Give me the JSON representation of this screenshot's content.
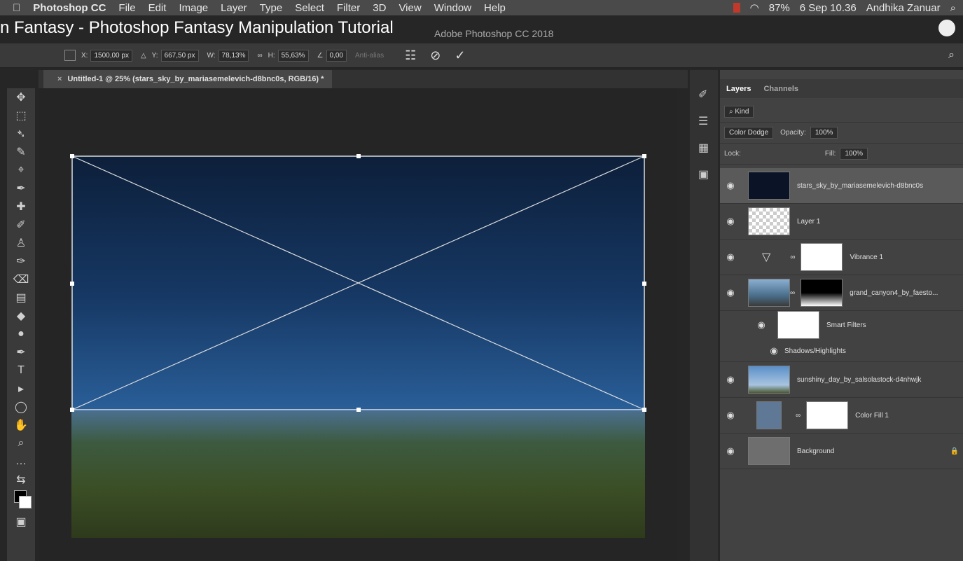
{
  "menubar": {
    "apple": "",
    "app": "Photoshop CC",
    "items": [
      "File",
      "Edit",
      "Image",
      "Layer",
      "Type",
      "Select",
      "Filter",
      "3D",
      "View",
      "Window",
      "Help"
    ],
    "battery": "87%",
    "clock": "6 Sep 10.36",
    "user": "Andhika Zanuar"
  },
  "overlay_title": "n Fantasy - Photoshop Fantasy Manipulation Tutorial",
  "window_title": "Adobe Photoshop CC 2018",
  "options": {
    "x_label": "X:",
    "x_value": "1500,00 px",
    "y_label": "Y:",
    "y_value": "667,50 px",
    "w_label": "W:",
    "w_value": "78,13%",
    "h_label": "H:",
    "h_value": "55,63%",
    "angle_value": "0,00",
    "antialias": "Anti-alias"
  },
  "document_tab": "Untitled-1 @ 25% (stars_sky_by_mariasemelevich-d8bnc0s, RGB/16) *",
  "layers_panel": {
    "tabs": [
      "Layers",
      "Channels"
    ],
    "kind_placeholder": "Kind",
    "blend_mode": "Color Dodge",
    "opacity_label": "Opacity:",
    "opacity_value": "100%",
    "lock_label": "Lock:",
    "fill_label": "Fill:",
    "fill_value": "100%",
    "layers": [
      {
        "name": "stars_sky_by_mariasemelevich-d8bnc0s"
      },
      {
        "name": "Layer 1"
      },
      {
        "name": "Vibrance 1"
      },
      {
        "name": "grand_canyon4_by_faesto..."
      },
      {
        "name": "Smart Filters"
      },
      {
        "name": "Shadows/Highlights"
      },
      {
        "name": "sunshiny_day_by_salsolastock-d4nhwjk"
      },
      {
        "name": "Color Fill 1"
      },
      {
        "name": "Background"
      }
    ]
  }
}
